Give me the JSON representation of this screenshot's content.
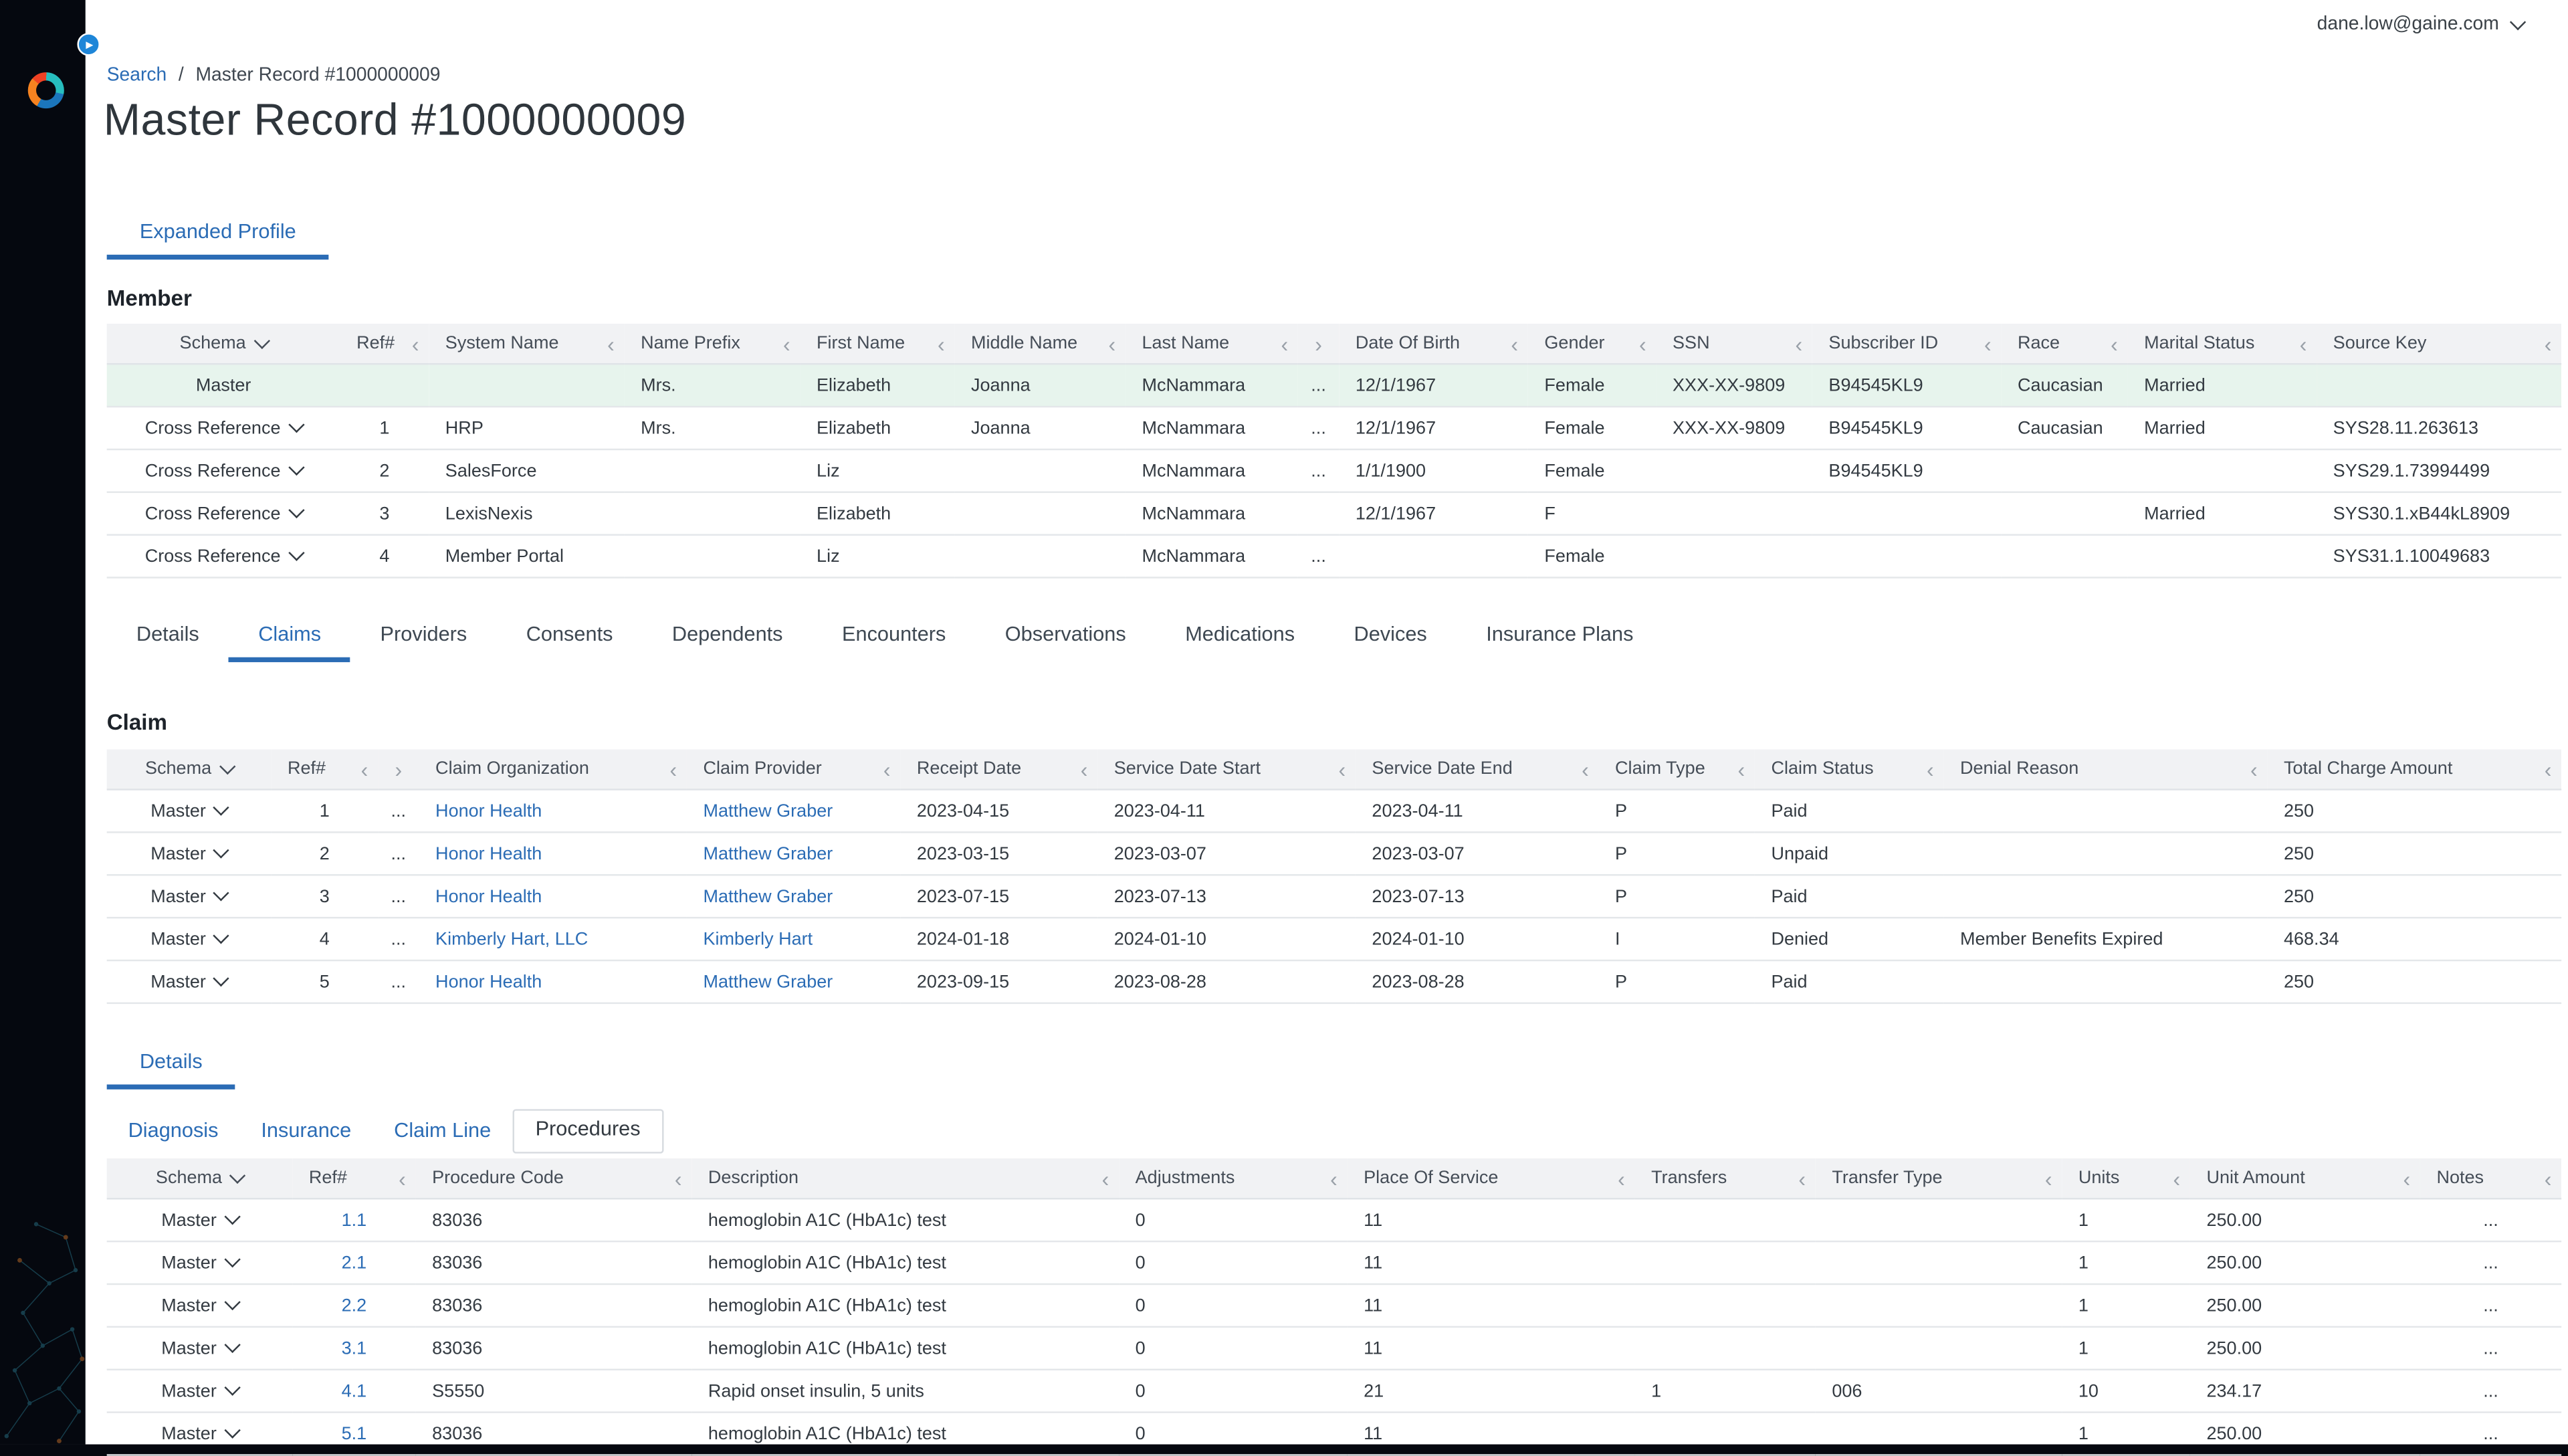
{
  "colors": {
    "accent": "#2b6cb5",
    "sidebar_bg": "#05080f",
    "toggle_blue": "#1e86d8",
    "header_bg": "#f1f2f4",
    "border": "#e4e7ea",
    "master_row_bg": "#e7f4ed"
  },
  "topbar": {
    "user_email": "dane.low@gaine.com"
  },
  "breadcrumb": {
    "link": "Search",
    "separator": "/",
    "current": "Master Record #1000000009"
  },
  "page_title": "Master Record #1000000009",
  "profile_tabs": [
    {
      "label": "Expanded Profile",
      "active": true
    }
  ],
  "member": {
    "title": "Member",
    "columns": [
      {
        "key": "schema",
        "label": "Schema",
        "kind": "schema"
      },
      {
        "key": "ref",
        "label": "Ref#",
        "kind": "num"
      },
      {
        "key": "system_name",
        "label": "System Name",
        "kind": "text"
      },
      {
        "key": "name_prefix",
        "label": "Name Prefix",
        "kind": "text"
      },
      {
        "key": "first_name",
        "label": "First Name",
        "kind": "text"
      },
      {
        "key": "middle_name",
        "label": "Middle Name",
        "kind": "text"
      },
      {
        "key": "last_name",
        "label": "Last Name",
        "kind": "text"
      },
      {
        "key": "more",
        "label": "",
        "kind": "expand"
      },
      {
        "key": "dob",
        "label": "Date Of Birth",
        "kind": "text"
      },
      {
        "key": "gender",
        "label": "Gender",
        "kind": "text"
      },
      {
        "key": "ssn",
        "label": "SSN",
        "kind": "text"
      },
      {
        "key": "subscriber_id",
        "label": "Subscriber ID",
        "kind": "text"
      },
      {
        "key": "race",
        "label": "Race",
        "kind": "text"
      },
      {
        "key": "marital_status",
        "label": "Marital Status",
        "kind": "text"
      },
      {
        "key": "source_key",
        "label": "Source Key",
        "kind": "text"
      }
    ],
    "rows": [
      {
        "schema": "Master",
        "schema_dropdown": false,
        "highlight": true,
        "ref": "",
        "system_name": "",
        "name_prefix": "Mrs.",
        "first_name": "Elizabeth",
        "middle_name": "Joanna",
        "last_name": "McNammara",
        "more": "...",
        "dob": "12/1/1967",
        "gender": "Female",
        "ssn": "XXX-XX-9809",
        "subscriber_id": "B94545KL9",
        "race": "Caucasian",
        "marital_status": "Married",
        "source_key": ""
      },
      {
        "schema": "Cross Reference",
        "schema_dropdown": true,
        "ref": "1",
        "system_name": "HRP",
        "name_prefix": "Mrs.",
        "first_name": "Elizabeth",
        "middle_name": "Joanna",
        "last_name": "McNammara",
        "more": "...",
        "dob": "12/1/1967",
        "gender": "Female",
        "ssn": "XXX-XX-9809",
        "subscriber_id": "B94545KL9",
        "race": "Caucasian",
        "marital_status": "Married",
        "source_key": "SYS28.11.263613"
      },
      {
        "schema": "Cross Reference",
        "schema_dropdown": true,
        "ref": "2",
        "system_name": "SalesForce",
        "name_prefix": "",
        "first_name": "Liz",
        "middle_name": "",
        "last_name": "McNammara",
        "more": "...",
        "dob": "1/1/1900",
        "gender": "Female",
        "ssn": "",
        "subscriber_id": "B94545KL9",
        "race": "",
        "marital_status": "",
        "source_key": "SYS29.1.73994499"
      },
      {
        "schema": "Cross Reference",
        "schema_dropdown": true,
        "ref": "3",
        "system_name": "LexisNexis",
        "name_prefix": "",
        "first_name": "Elizabeth",
        "middle_name": "",
        "last_name": "McNammara",
        "more": "",
        "dob": "12/1/1967",
        "gender": "F",
        "ssn": "",
        "subscriber_id": "",
        "race": "",
        "marital_status": "Married",
        "source_key": "SYS30.1.xB44kL8909"
      },
      {
        "schema": "Cross Reference",
        "schema_dropdown": true,
        "ref": "4",
        "system_name": "Member Portal",
        "name_prefix": "",
        "first_name": "Liz",
        "middle_name": "",
        "last_name": "McNammara",
        "more": "...",
        "dob": "",
        "gender": "Female",
        "ssn": "",
        "subscriber_id": "",
        "race": "",
        "marital_status": "",
        "source_key": "SYS31.1.10049683"
      }
    ]
  },
  "record_tabs": [
    {
      "label": "Details"
    },
    {
      "label": "Claims",
      "active": true
    },
    {
      "label": "Providers"
    },
    {
      "label": "Consents"
    },
    {
      "label": "Dependents"
    },
    {
      "label": "Encounters"
    },
    {
      "label": "Observations"
    },
    {
      "label": "Medications"
    },
    {
      "label": "Devices"
    },
    {
      "label": "Insurance Plans"
    }
  ],
  "claim": {
    "title": "Claim",
    "columns": [
      {
        "key": "schema",
        "label": "Schema",
        "kind": "schema"
      },
      {
        "key": "ref",
        "label": "Ref#",
        "kind": "num"
      },
      {
        "key": "more",
        "label": "",
        "kind": "expand"
      },
      {
        "key": "claim_organization",
        "label": "Claim Organization",
        "kind": "link"
      },
      {
        "key": "claim_provider",
        "label": "Claim Provider",
        "kind": "link"
      },
      {
        "key": "receipt_date",
        "label": "Receipt Date",
        "kind": "text"
      },
      {
        "key": "service_date_start",
        "label": "Service Date Start",
        "kind": "text"
      },
      {
        "key": "service_date_end",
        "label": "Service Date End",
        "kind": "text"
      },
      {
        "key": "claim_type",
        "label": "Claim Type",
        "kind": "text"
      },
      {
        "key": "claim_status",
        "label": "Claim Status",
        "kind": "text"
      },
      {
        "key": "denial_reason",
        "label": "Denial Reason",
        "kind": "text"
      },
      {
        "key": "total_charge_amount",
        "label": "Total Charge Amount",
        "kind": "text"
      }
    ],
    "rows": [
      {
        "schema": "Master",
        "schema_dropdown": true,
        "ref": "1",
        "more": "...",
        "claim_organization": "Honor Health",
        "claim_provider": "Matthew Graber",
        "receipt_date": "2023-04-15",
        "service_date_start": "2023-04-11",
        "service_date_end": "2023-04-11",
        "claim_type": "P",
        "claim_status": "Paid",
        "denial_reason": "",
        "total_charge_amount": "250"
      },
      {
        "schema": "Master",
        "schema_dropdown": true,
        "ref": "2",
        "more": "...",
        "claim_organization": "Honor Health",
        "claim_provider": "Matthew Graber",
        "receipt_date": "2023-03-15",
        "service_date_start": "2023-03-07",
        "service_date_end": "2023-03-07",
        "claim_type": "P",
        "claim_status": "Unpaid",
        "denial_reason": "",
        "total_charge_amount": "250"
      },
      {
        "schema": "Master",
        "schema_dropdown": true,
        "ref": "3",
        "more": "...",
        "claim_organization": "Honor Health",
        "claim_provider": "Matthew Graber",
        "receipt_date": "2023-07-15",
        "service_date_start": "2023-07-13",
        "service_date_end": "2023-07-13",
        "claim_type": "P",
        "claim_status": "Paid",
        "denial_reason": "",
        "total_charge_amount": "250"
      },
      {
        "schema": "Master",
        "schema_dropdown": true,
        "ref": "4",
        "more": "...",
        "claim_organization": "Kimberly Hart, LLC",
        "claim_provider": "Kimberly Hart",
        "receipt_date": "2024-01-18",
        "service_date_start": "2024-01-10",
        "service_date_end": "2024-01-10",
        "claim_type": "I",
        "claim_status": "Denied",
        "denial_reason": "Member Benefits Expired",
        "total_charge_amount": "468.34"
      },
      {
        "schema": "Master",
        "schema_dropdown": true,
        "ref": "5",
        "more": "...",
        "claim_organization": "Honor Health",
        "claim_provider": "Matthew Graber",
        "receipt_date": "2023-09-15",
        "service_date_start": "2023-08-28",
        "service_date_end": "2023-08-28",
        "claim_type": "P",
        "claim_status": "Paid",
        "denial_reason": "",
        "total_charge_amount": "250"
      }
    ]
  },
  "details_tabs": [
    {
      "label": "Details",
      "active": true
    }
  ],
  "claim_subtabs": [
    {
      "label": "Diagnosis"
    },
    {
      "label": "Insurance"
    },
    {
      "label": "Claim Line"
    },
    {
      "label": "Procedures",
      "active": true
    }
  ],
  "procedures": {
    "columns": [
      {
        "key": "schema",
        "label": "Schema",
        "kind": "schema"
      },
      {
        "key": "ref",
        "label": "Ref#",
        "kind": "reflink"
      },
      {
        "key": "procedure_code",
        "label": "Procedure Code",
        "kind": "text"
      },
      {
        "key": "description",
        "label": "Description",
        "kind": "text"
      },
      {
        "key": "adjustments",
        "label": "Adjustments",
        "kind": "text"
      },
      {
        "key": "place_of_service",
        "label": "Place Of Service",
        "kind": "text"
      },
      {
        "key": "transfers",
        "label": "Transfers",
        "kind": "text"
      },
      {
        "key": "transfer_type",
        "label": "Transfer Type",
        "kind": "text"
      },
      {
        "key": "units",
        "label": "Units",
        "kind": "text"
      },
      {
        "key": "unit_amount",
        "label": "Unit Amount",
        "kind": "text"
      },
      {
        "key": "notes",
        "label": "Notes",
        "kind": "dots"
      }
    ],
    "rows": [
      {
        "schema": "Master",
        "schema_dropdown": true,
        "ref": "1.1",
        "procedure_code": "83036",
        "description": "hemoglobin A1C (HbA1c) test",
        "adjustments": "0",
        "place_of_service": "11",
        "transfers": "",
        "transfer_type": "",
        "units": "1",
        "unit_amount": "250.00",
        "notes": "..."
      },
      {
        "schema": "Master",
        "schema_dropdown": true,
        "ref": "2.1",
        "procedure_code": "83036",
        "description": "hemoglobin A1C (HbA1c) test",
        "adjustments": "0",
        "place_of_service": "11",
        "transfers": "",
        "transfer_type": "",
        "units": "1",
        "unit_amount": "250.00",
        "notes": "..."
      },
      {
        "schema": "Master",
        "schema_dropdown": true,
        "ref": "2.2",
        "procedure_code": "83036",
        "description": "hemoglobin A1C (HbA1c) test",
        "adjustments": "0",
        "place_of_service": "11",
        "transfers": "",
        "transfer_type": "",
        "units": "1",
        "unit_amount": "250.00",
        "notes": "..."
      },
      {
        "schema": "Master",
        "schema_dropdown": true,
        "ref": "3.1",
        "procedure_code": "83036",
        "description": "hemoglobin A1C (HbA1c) test",
        "adjustments": "0",
        "place_of_service": "11",
        "transfers": "",
        "transfer_type": "",
        "units": "1",
        "unit_amount": "250.00",
        "notes": "..."
      },
      {
        "schema": "Master",
        "schema_dropdown": true,
        "ref": "4.1",
        "procedure_code": "S5550",
        "description": "Rapid onset insulin, 5 units",
        "adjustments": "0",
        "place_of_service": "21",
        "transfers": "1",
        "transfer_type": "006",
        "units": "10",
        "unit_amount": "234.17",
        "notes": "..."
      },
      {
        "schema": "Master",
        "schema_dropdown": true,
        "ref": "5.1",
        "procedure_code": "83036",
        "description": "hemoglobin A1C (HbA1c) test",
        "adjustments": "0",
        "place_of_service": "11",
        "transfers": "",
        "transfer_type": "",
        "units": "1",
        "unit_amount": "250.00",
        "notes": "..."
      }
    ]
  }
}
